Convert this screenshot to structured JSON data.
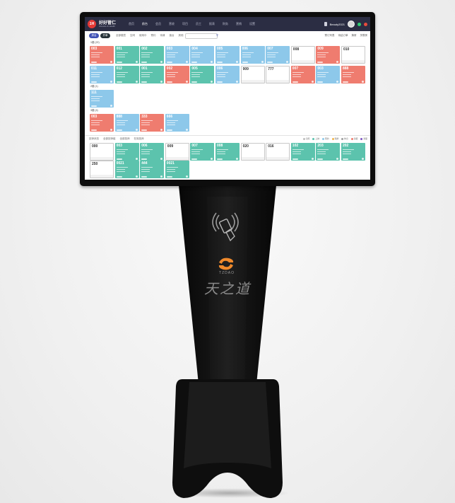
{
  "kiosk": {
    "brand_text": "天之道",
    "logo_sub": "TZDAO"
  },
  "app": {
    "logo_badge": "1H",
    "brand_name": "好好管仁",
    "brand_sub": "Lifecare & Health",
    "nav": [
      "首页",
      "前台",
      "会员",
      "营收",
      "项目",
      "员工",
      "报表",
      "财务",
      "营销",
      "设置"
    ],
    "nav_active_index": 1,
    "user_name": "Beauty2021",
    "status_colors": [
      "#2ecc71",
      "#e74c3c"
    ]
  },
  "toolbar": {
    "tabs": [
      "房台",
      "开单"
    ],
    "filters": [
      "全部楼层",
      "空闲",
      "使用中",
      "预约",
      "待清",
      "锁台",
      "其他"
    ],
    "right_items": [
      "预订列表",
      "待结订单",
      "换房",
      "关联房"
    ]
  },
  "areas": [
    {
      "label": "1楼 (22)"
    },
    {
      "label": "2楼 (1)"
    },
    {
      "label": "3楼 (4)"
    }
  ],
  "rooms_row1": [
    {
      "num": "003",
      "color": "red"
    },
    {
      "num": "001",
      "color": "green"
    },
    {
      "num": "002",
      "color": "green"
    },
    {
      "num": "003",
      "color": "blue"
    },
    {
      "num": "004",
      "color": "blue"
    },
    {
      "num": "005",
      "color": "blue"
    },
    {
      "num": "006",
      "color": "blue"
    },
    {
      "num": "007",
      "color": "blue"
    },
    {
      "num": "008",
      "color": "empty"
    },
    {
      "num": "009",
      "color": "red"
    },
    {
      "num": "010",
      "color": "empty"
    }
  ],
  "rooms_row2": [
    {
      "num": "011",
      "color": "blue"
    },
    {
      "num": "012",
      "color": "green"
    },
    {
      "num": "001",
      "color": "green"
    },
    {
      "num": "002",
      "color": "red"
    },
    {
      "num": "005",
      "color": "green"
    },
    {
      "num": "006",
      "color": "blue"
    },
    {
      "num": "909",
      "color": "empty"
    },
    {
      "num": "777",
      "color": "empty"
    },
    {
      "num": "007",
      "color": "red"
    },
    {
      "num": "003",
      "color": "blue"
    },
    {
      "num": "888",
      "color": "red"
    }
  ],
  "rooms_floor2": [
    {
      "num": "111",
      "color": "blue"
    }
  ],
  "rooms_floor3": [
    {
      "num": "003",
      "color": "red"
    },
    {
      "num": "888",
      "color": "blue"
    },
    {
      "num": "333",
      "color": "red"
    },
    {
      "num": "666",
      "color": "blue"
    }
  ],
  "bottom_bar": {
    "filters": [
      "技师状态",
      "全部技师组",
      "全部技师",
      "在岗技师"
    ],
    "legend": [
      "空闲",
      "上钟",
      "预约",
      "轮牌",
      "休息",
      "请假",
      "离职"
    ]
  },
  "techs_row1": [
    {
      "num": "000",
      "color": "empty"
    },
    {
      "num": "003",
      "color": "green"
    },
    {
      "num": "006",
      "color": "green"
    },
    {
      "num": "009",
      "color": "empty"
    },
    {
      "num": "007",
      "color": "green"
    },
    {
      "num": "008",
      "color": "green"
    },
    {
      "num": "020",
      "color": "empty"
    },
    {
      "num": "016",
      "color": "empty"
    },
    {
      "num": "102",
      "color": "green"
    },
    {
      "num": "203",
      "color": "green"
    },
    {
      "num": "202",
      "color": "green"
    }
  ],
  "techs_row2": [
    {
      "num": "250",
      "color": "empty"
    },
    {
      "num": "0021",
      "color": "green"
    },
    {
      "num": "444",
      "color": "green"
    },
    {
      "num": "0021",
      "color": "green"
    }
  ]
}
